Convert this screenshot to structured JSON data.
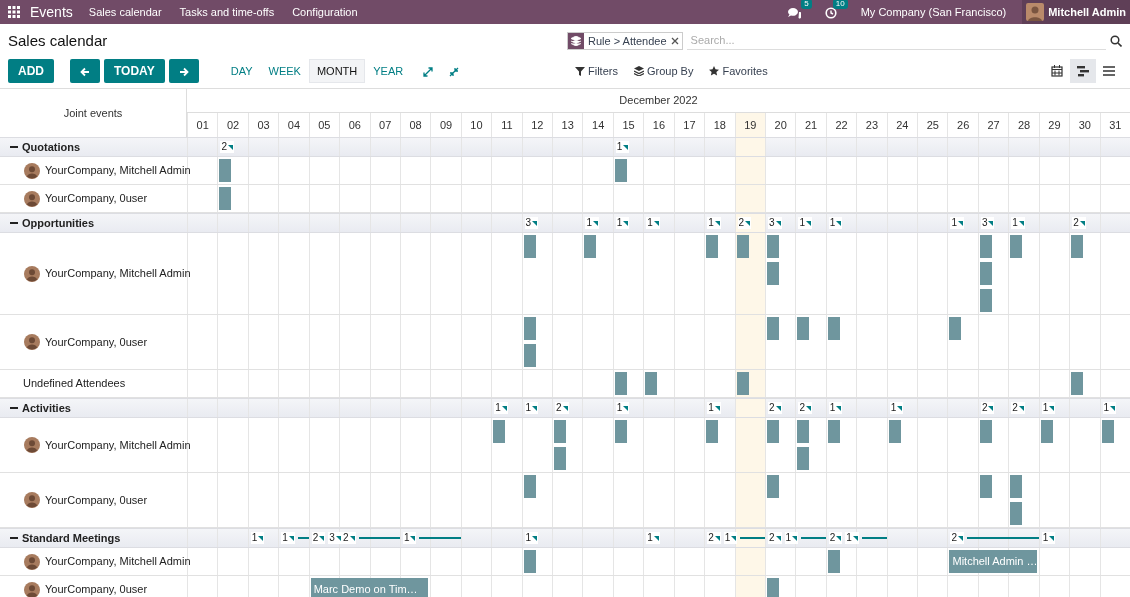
{
  "app": {
    "name": "Events",
    "menu": [
      "Sales calendar",
      "Tasks and time-offs",
      "Configuration"
    ],
    "messages": "5",
    "activities": "10",
    "company": "My Company (San Francisco)",
    "user": "Mitchell Admin"
  },
  "title": "Sales calendar",
  "search": {
    "facet": "Rule > Attendee",
    "placeholder": "Search..."
  },
  "buttons": {
    "add": "ADD",
    "today": "TODAY"
  },
  "scales": [
    {
      "label": "DAY",
      "selected": false
    },
    {
      "label": "WEEK",
      "selected": false
    },
    {
      "label": "MONTH",
      "selected": true
    },
    {
      "label": "YEAR",
      "selected": false
    }
  ],
  "filters": [
    {
      "kind": "filter",
      "label": "Filters"
    },
    {
      "kind": "groupby",
      "label": "Group By"
    },
    {
      "kind": "favorites",
      "label": "Favorites"
    }
  ],
  "views": [
    {
      "kind": "calendar",
      "selected": false
    },
    {
      "kind": "gantt",
      "selected": true
    },
    {
      "kind": "list",
      "selected": false
    }
  ],
  "gantt": {
    "row_header": "Joint events",
    "month": "December 2022",
    "days": [
      {
        "label": "01",
        "today": false
      },
      {
        "label": "02",
        "today": false
      },
      {
        "label": "03",
        "today": false
      },
      {
        "label": "04",
        "today": false
      },
      {
        "label": "05",
        "today": false
      },
      {
        "label": "06",
        "today": false
      },
      {
        "label": "07",
        "today": false
      },
      {
        "label": "08",
        "today": false
      },
      {
        "label": "09",
        "today": false
      },
      {
        "label": "10",
        "today": false
      },
      {
        "label": "11",
        "today": false
      },
      {
        "label": "12",
        "today": false
      },
      {
        "label": "13",
        "today": false
      },
      {
        "label": "14",
        "today": false
      },
      {
        "label": "15",
        "today": false
      },
      {
        "label": "16",
        "today": false
      },
      {
        "label": "17",
        "today": false
      },
      {
        "label": "18",
        "today": false
      },
      {
        "label": "19",
        "today": true
      },
      {
        "label": "20",
        "today": false
      },
      {
        "label": "21",
        "today": false
      },
      {
        "label": "22",
        "today": false
      },
      {
        "label": "23",
        "today": false
      },
      {
        "label": "24",
        "today": false
      },
      {
        "label": "25",
        "today": false
      },
      {
        "label": "26",
        "today": false
      },
      {
        "label": "27",
        "today": false
      },
      {
        "label": "28",
        "today": false
      },
      {
        "label": "29",
        "today": false
      },
      {
        "label": "30",
        "today": false
      },
      {
        "label": "31",
        "today": false
      }
    ],
    "groups": [
      {
        "name": "Quotations",
        "expanded": true,
        "cells": [
          {},
          {
            "pills": [
              {
                "label": "2",
                "kind": "count"
              }
            ]
          },
          {},
          {},
          {},
          {},
          {},
          {},
          {},
          {},
          {},
          {},
          {},
          {},
          {
            "pills": [
              {
                "label": "1",
                "kind": "count"
              }
            ]
          },
          {},
          {},
          {},
          {},
          {},
          {},
          {},
          {},
          {},
          {},
          {},
          {},
          {},
          {},
          {},
          {}
        ],
        "rows": [
          {
            "name": "YourCompany, Mitchell Admin",
            "avatar": true,
            "cells": [
              {},
              {
                "bars": [
                  {
                    "kind": "block"
                  }
                ]
              },
              {},
              {},
              {},
              {},
              {},
              {},
              {},
              {},
              {},
              {},
              {},
              {},
              {
                "bars": [
                  {
                    "kind": "block"
                  }
                ]
              },
              {},
              {},
              {},
              {},
              {},
              {},
              {},
              {},
              {},
              {},
              {},
              {},
              {},
              {},
              {},
              {}
            ]
          },
          {
            "name": "YourCompany, 0user",
            "avatar": true,
            "cells": [
              {},
              {
                "bars": [
                  {
                    "kind": "block"
                  }
                ]
              },
              {},
              {},
              {},
              {},
              {},
              {},
              {},
              {},
              {},
              {},
              {},
              {},
              {},
              {},
              {},
              {},
              {},
              {},
              {},
              {},
              {},
              {},
              {},
              {},
              {},
              {},
              {},
              {},
              {}
            ]
          }
        ]
      },
      {
        "name": "Opportunities",
        "expanded": true,
        "cells": [
          {},
          {},
          {},
          {},
          {},
          {},
          {},
          {},
          {},
          {},
          {},
          {
            "pills": [
              {
                "label": "3",
                "kind": "count"
              }
            ]
          },
          {},
          {
            "pills": [
              {
                "label": "1",
                "kind": "count"
              }
            ]
          },
          {
            "pills": [
              {
                "label": "1",
                "kind": "count"
              }
            ]
          },
          {
            "pills": [
              {
                "label": "1",
                "kind": "count"
              }
            ]
          },
          {},
          {
            "pills": [
              {
                "label": "1",
                "kind": "count"
              }
            ]
          },
          {
            "pills": [
              {
                "label": "2",
                "kind": "count"
              }
            ]
          },
          {
            "pills": [
              {
                "label": "3",
                "kind": "count"
              }
            ]
          },
          {
            "pills": [
              {
                "label": "1",
                "kind": "count"
              }
            ]
          },
          {
            "pills": [
              {
                "label": "1",
                "kind": "count"
              }
            ]
          },
          {},
          {},
          {},
          {
            "pills": [
              {
                "label": "1",
                "kind": "count"
              }
            ]
          },
          {
            "pills": [
              {
                "label": "3",
                "kind": "count"
              }
            ]
          },
          {
            "pills": [
              {
                "label": "1",
                "kind": "count"
              }
            ]
          },
          {},
          {
            "pills": [
              {
                "label": "2",
                "kind": "count"
              }
            ]
          },
          {}
        ],
        "rows": [
          {
            "name": "YourCompany, Mitchell Admin",
            "avatar": true,
            "cells": [
              {},
              {},
              {},
              {},
              {},
              {},
              {},
              {},
              {},
              {},
              {},
              {
                "bars": [
                  {
                    "kind": "block"
                  }
                ]
              },
              {},
              {
                "bars": [
                  {
                    "kind": "block"
                  }
                ]
              },
              {},
              {},
              {},
              {
                "bars": [
                  {
                    "kind": "block"
                  }
                ]
              },
              {
                "bars": [
                  {
                    "kind": "block"
                  }
                ]
              },
              {
                "bars": [
                  {
                    "kind": "block"
                  },
                  {
                    "kind": "block"
                  }
                ]
              },
              {},
              {},
              {},
              {},
              {},
              {},
              {
                "bars": [
                  {
                    "kind": "block"
                  },
                  {
                    "kind": "block"
                  },
                  {
                    "kind": "block"
                  }
                ]
              },
              {
                "bars": [
                  {
                    "kind": "block"
                  }
                ]
              },
              {},
              {
                "bars": [
                  {
                    "kind": "block"
                  }
                ]
              },
              {}
            ]
          },
          {
            "name": "YourCompany, 0user",
            "avatar": true,
            "cells": [
              {},
              {},
              {},
              {},
              {},
              {},
              {},
              {},
              {},
              {},
              {},
              {
                "bars": [
                  {
                    "kind": "block"
                  },
                  {
                    "kind": "block"
                  }
                ]
              },
              {},
              {},
              {},
              {},
              {},
              {},
              {},
              {
                "bars": [
                  {
                    "kind": "block"
                  }
                ]
              },
              {
                "bars": [
                  {
                    "kind": "block"
                  }
                ]
              },
              {
                "bars": [
                  {
                    "kind": "block"
                  }
                ]
              },
              {},
              {},
              {},
              {
                "bars": [
                  {
                    "kind": "block"
                  }
                ]
              },
              {},
              {},
              {},
              {},
              {}
            ]
          },
          {
            "name": "Undefined Attendees",
            "avatar": false,
            "cells": [
              {},
              {},
              {},
              {},
              {},
              {},
              {},
              {},
              {},
              {},
              {},
              {},
              {},
              {},
              {
                "bars": [
                  {
                    "kind": "block"
                  }
                ]
              },
              {
                "bars": [
                  {
                    "kind": "block"
                  }
                ]
              },
              {},
              {},
              {
                "bars": [
                  {
                    "kind": "block"
                  }
                ]
              },
              {},
              {},
              {},
              {},
              {},
              {},
              {},
              {},
              {},
              {},
              {
                "bars": [
                  {
                    "kind": "block"
                  }
                ]
              },
              {}
            ]
          }
        ]
      },
      {
        "name": "Activities",
        "expanded": true,
        "cells": [
          {},
          {},
          {},
          {},
          {},
          {},
          {},
          {},
          {},
          {},
          {
            "pills": [
              {
                "label": "1",
                "kind": "count"
              }
            ]
          },
          {
            "pills": [
              {
                "label": "1",
                "kind": "count"
              }
            ]
          },
          {
            "pills": [
              {
                "label": "2",
                "kind": "count"
              }
            ]
          },
          {},
          {
            "pills": [
              {
                "label": "1",
                "kind": "count"
              }
            ]
          },
          {},
          {},
          {
            "pills": [
              {
                "label": "1",
                "kind": "count"
              }
            ]
          },
          {},
          {
            "pills": [
              {
                "label": "2",
                "kind": "count"
              }
            ]
          },
          {
            "pills": [
              {
                "label": "2",
                "kind": "count"
              }
            ]
          },
          {
            "pills": [
              {
                "label": "1",
                "kind": "count"
              }
            ]
          },
          {},
          {
            "pills": [
              {
                "label": "1",
                "kind": "count"
              }
            ]
          },
          {},
          {},
          {
            "pills": [
              {
                "label": "2",
                "kind": "count"
              }
            ]
          },
          {
            "pills": [
              {
                "label": "2",
                "kind": "count"
              }
            ]
          },
          {
            "pills": [
              {
                "label": "1",
                "kind": "count"
              }
            ]
          },
          {},
          {
            "pills": [
              {
                "label": "1",
                "kind": "count"
              }
            ]
          }
        ],
        "rows": [
          {
            "name": "YourCompany, Mitchell Admin",
            "avatar": true,
            "cells": [
              {},
              {},
              {},
              {},
              {},
              {},
              {},
              {},
              {},
              {},
              {
                "bars": [
                  {
                    "kind": "block"
                  }
                ]
              },
              {},
              {
                "bars": [
                  {
                    "kind": "block"
                  },
                  {
                    "kind": "block"
                  }
                ]
              },
              {},
              {
                "bars": [
                  {
                    "kind": "block"
                  }
                ]
              },
              {},
              {},
              {
                "bars": [
                  {
                    "kind": "block"
                  }
                ]
              },
              {},
              {
                "bars": [
                  {
                    "kind": "block"
                  }
                ]
              },
              {
                "bars": [
                  {
                    "kind": "block"
                  },
                  {
                    "kind": "block"
                  }
                ]
              },
              {
                "bars": [
                  {
                    "kind": "block"
                  }
                ]
              },
              {},
              {
                "bars": [
                  {
                    "kind": "block"
                  }
                ]
              },
              {},
              {},
              {
                "bars": [
                  {
                    "kind": "block"
                  }
                ]
              },
              {},
              {
                "bars": [
                  {
                    "kind": "block"
                  }
                ]
              },
              {},
              {
                "bars": [
                  {
                    "kind": "block"
                  }
                ]
              }
            ]
          },
          {
            "name": "YourCompany, 0user",
            "avatar": true,
            "cells": [
              {},
              {},
              {},
              {},
              {},
              {},
              {},
              {},
              {},
              {},
              {},
              {
                "bars": [
                  {
                    "kind": "block"
                  }
                ]
              },
              {},
              {},
              {},
              {},
              {},
              {},
              {},
              {
                "bars": [
                  {
                    "kind": "block"
                  }
                ]
              },
              {},
              {},
              {},
              {},
              {},
              {},
              {
                "bars": [
                  {
                    "kind": "block"
                  }
                ]
              },
              {
                "bars": [
                  {
                    "kind": "block"
                  },
                  {
                    "kind": "block"
                  }
                ]
              },
              {},
              {},
              {}
            ]
          }
        ]
      },
      {
        "name": "Standard Meetings",
        "expanded": true,
        "cells": [
          {},
          {},
          {
            "pills": [
              {
                "label": "1",
                "kind": "count"
              }
            ]
          },
          {
            "pills": [
              {
                "label": "1",
                "kind": "span"
              }
            ]
          },
          {
            "pills": [
              {
                "label": "2",
                "kind": "count"
              },
              {
                "label": "3",
                "kind": "count"
              }
            ]
          },
          {
            "pills": [
              {
                "label": "2",
                "kind": "span"
              }
            ]
          },
          {
            "continues": true
          },
          {
            "pills": [
              {
                "label": "1",
                "kind": "span"
              }
            ]
          },
          {
            "continues": true
          },
          {},
          {},
          {
            "pills": [
              {
                "label": "1",
                "kind": "count"
              }
            ]
          },
          {},
          {},
          {},
          {
            "pills": [
              {
                "label": "1",
                "kind": "count"
              }
            ]
          },
          {},
          {
            "pills": [
              {
                "label": "2",
                "kind": "count"
              },
              {
                "label": "1",
                "kind": "span"
              }
            ]
          },
          {
            "continues": true
          },
          {
            "pills": [
              {
                "label": "2",
                "kind": "count"
              },
              {
                "label": "1",
                "kind": "span"
              }
            ]
          },
          {
            "continues": true
          },
          {
            "pills": [
              {
                "label": "2",
                "kind": "count"
              },
              {
                "label": "1",
                "kind": "span"
              }
            ]
          },
          {
            "continues": true
          },
          {},
          {},
          {
            "pills": [
              {
                "label": "2",
                "kind": "span"
              }
            ]
          },
          {
            "continues": true
          },
          {
            "continues": true
          },
          {
            "pills": [
              {
                "label": "1",
                "kind": "count"
              }
            ]
          },
          {},
          {}
        ],
        "rows": [
          {
            "name": "YourCompany, Mitchell Admin",
            "avatar": true,
            "cells": [
              {},
              {},
              {},
              {},
              {},
              {},
              {},
              {},
              {},
              {},
              {},
              {
                "bars": [
                  {
                    "kind": "block"
                  }
                ]
              },
              {},
              {},
              {},
              {},
              {},
              {},
              {},
              {},
              {},
              {
                "bars": [
                  {
                    "kind": "block"
                  }
                ]
              },
              {},
              {},
              {},
              {
                "bars": [
                  {
                    "kind": "labeled",
                    "label": "Mitchell Admin …"
                  }
                ]
              },
              {
                "continues": true
              },
              {
                "continues": true
              },
              {},
              {},
              {}
            ]
          },
          {
            "name": "YourCompany, 0user",
            "avatar": true,
            "cells": [
              {},
              {},
              {},
              {},
              {
                "bars": [
                  {
                    "kind": "labeled",
                    "label": "Marc Demo on Tim…"
                  }
                ]
              },
              {
                "continues": true
              },
              {
                "continues": true
              },
              {
                "continues": true
              },
              {},
              {},
              {},
              {},
              {},
              {},
              {},
              {},
              {},
              {},
              {},
              {
                "bars": [
                  {
                    "kind": "block"
                  }
                ]
              },
              {},
              {},
              {},
              {},
              {},
              {},
              {},
              {},
              {},
              {},
              {}
            ]
          }
        ]
      }
    ]
  }
}
